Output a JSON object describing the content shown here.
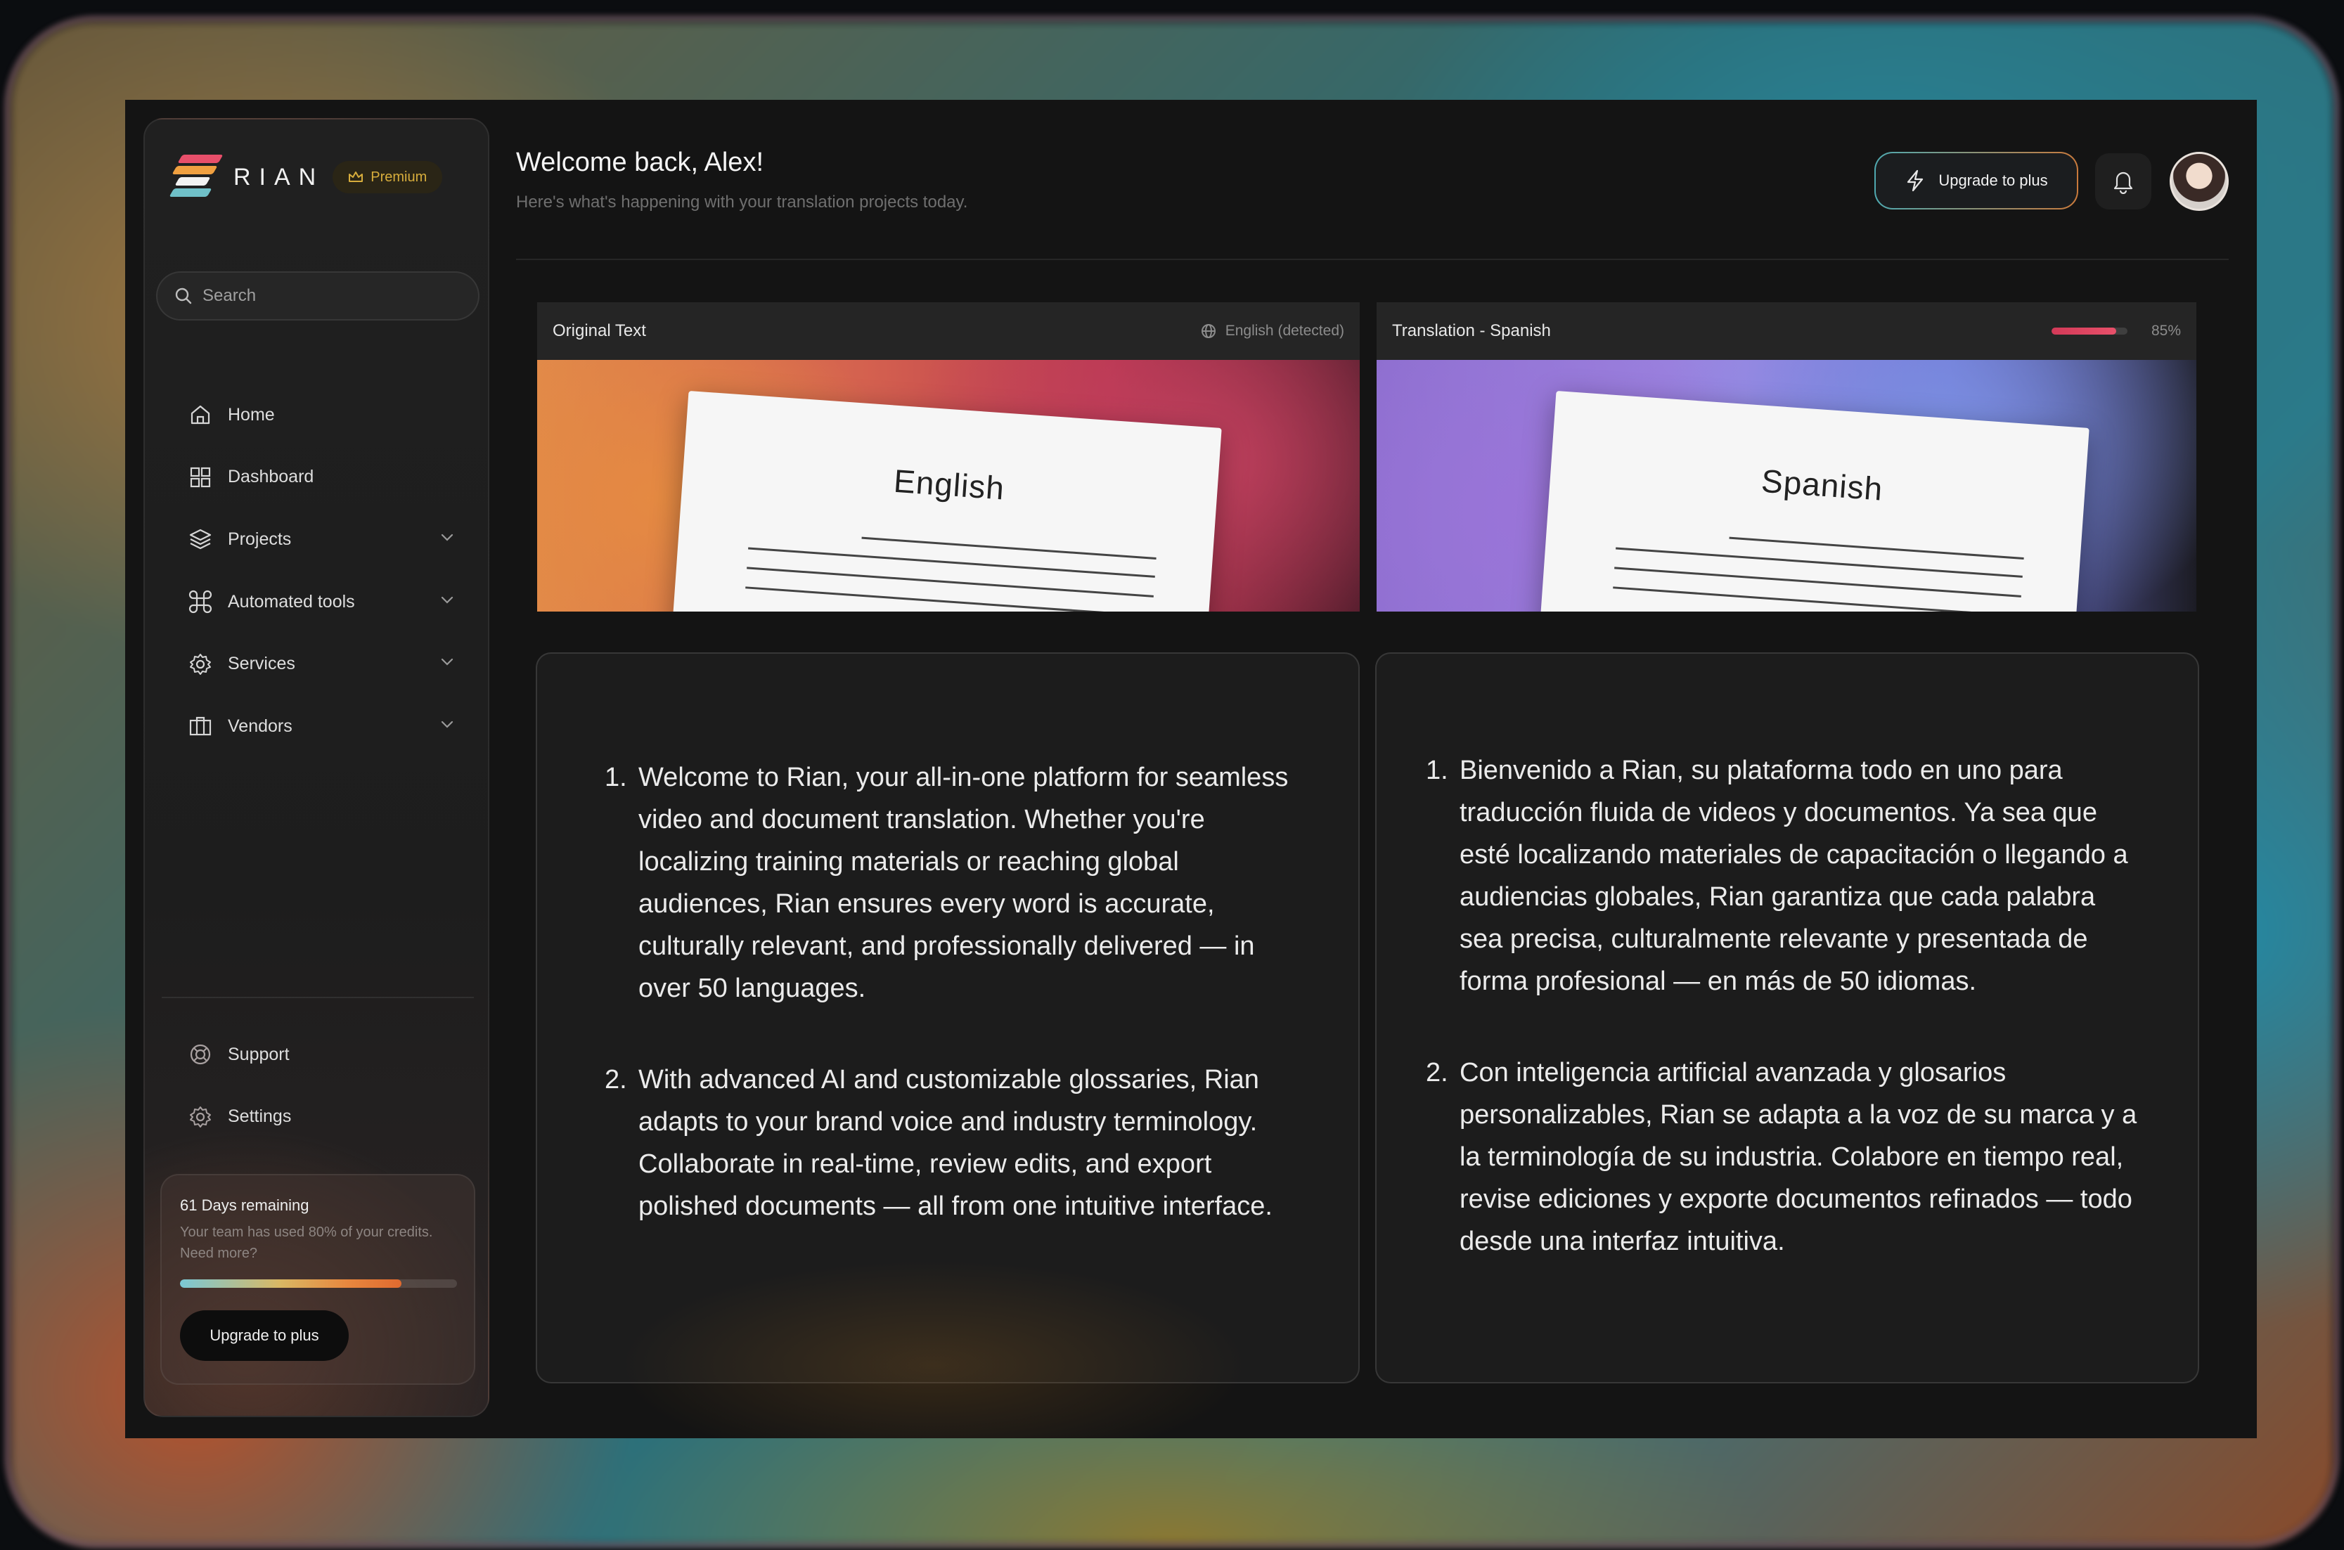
{
  "brand": {
    "name": "RIAN",
    "badge": "Premium"
  },
  "search": {
    "placeholder": "Search"
  },
  "nav": {
    "items": [
      {
        "label": "Home",
        "icon": "home-icon"
      },
      {
        "label": "Dashboard",
        "icon": "grid-icon"
      },
      {
        "label": "Projects",
        "icon": "layers-icon",
        "expandable": true
      },
      {
        "label": "Automated tools",
        "icon": "command-icon",
        "expandable": true
      },
      {
        "label": "Services",
        "icon": "gear-icon",
        "expandable": true
      },
      {
        "label": "Vendors",
        "icon": "briefcase-icon",
        "expandable": true
      }
    ],
    "bottom": [
      {
        "label": "Support",
        "icon": "lifebuoy-icon"
      },
      {
        "label": "Settings",
        "icon": "settings-icon"
      }
    ]
  },
  "credits": {
    "title": "61 Days remaining",
    "description": "Your team has used 80% of your credits. Need more?",
    "progress": 0.8,
    "button": "Upgrade to plus"
  },
  "header": {
    "title": "Welcome back, Alex!",
    "subtitle": "Here's what's happening with your translation projects today.",
    "upgrade": "Upgrade to plus"
  },
  "original": {
    "title": "Original Text",
    "language": "English (detected)",
    "image_word": "English",
    "paragraphs": [
      {
        "num": "1.",
        "text": "Welcome to Rian, your all-in-one platform for seamless video and document translation. Whether you're localizing training materials or reaching global audiences, Rian ensures every word is accurate, culturally relevant, and professionally delivered — in over 50 languages."
      },
      {
        "num": "2.",
        "text": "With advanced AI and customizable glossaries, Rian adapts to your brand voice and industry terminology. Collaborate in real-time, review edits, and export polished documents — all from one intuitive interface."
      }
    ]
  },
  "translation": {
    "title": "Translation - Spanish",
    "progress_label": "85%",
    "progress": 0.85,
    "image_word": "Spanish",
    "paragraphs": [
      {
        "num": "1.",
        "text": "Bienvenido a Rian, su plataforma todo en uno para traducción fluida de videos y documentos. Ya sea que esté localizando materiales de capacitación o llegando a audiencias globales, Rian garantiza que cada palabra sea precisa, culturalmente relevante y presentada de forma profesional — en más de 50 idiomas."
      },
      {
        "num": "2.",
        "text": "Con inteligencia artificial avanzada y glosarios personalizables, Rian se adapta a la voz de su marca y a la terminología de su industria. Colabore en tiempo real, revise ediciones y exporte documentos refinados — todo desde una interfaz intuitiva."
      }
    ]
  },
  "colors": {
    "accent_gold": "#d7ad3c",
    "progress_red": "#d33a58",
    "background": "#141414"
  }
}
